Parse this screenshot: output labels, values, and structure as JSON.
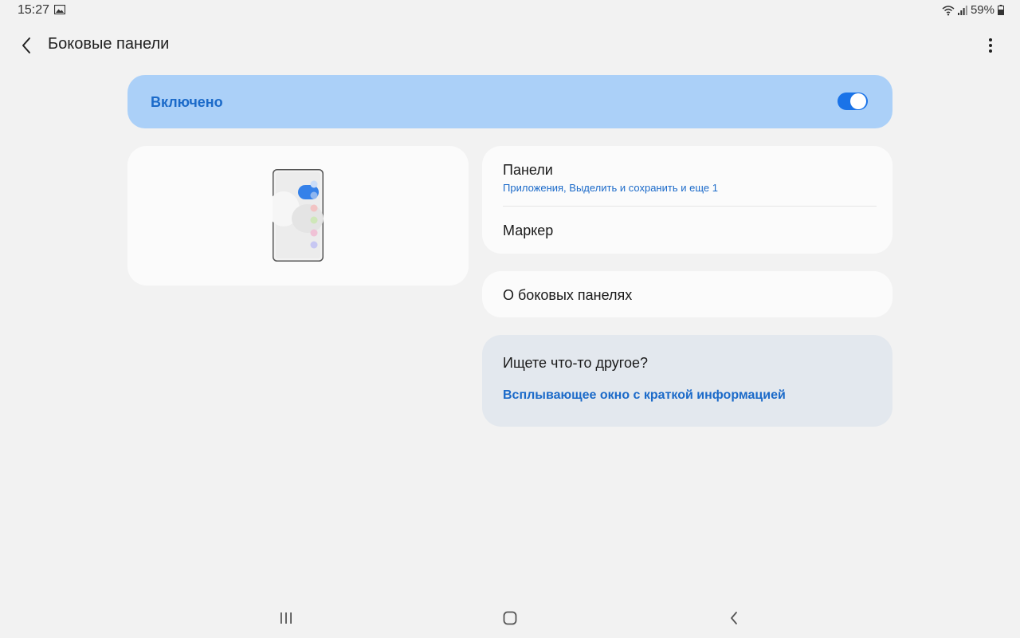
{
  "status_bar": {
    "time": "15:27",
    "battery": "59%"
  },
  "app_bar": {
    "title": "Боковые панели"
  },
  "master_switch": {
    "label": "Включено",
    "checked": true,
    "accent": "#1a73e8"
  },
  "settings": {
    "panels": {
      "title": "Панели",
      "summary": "Приложения, Выделить и сохранить и еще 1"
    },
    "marker": {
      "title": "Маркер"
    },
    "about": {
      "title": "О боковых панелях"
    }
  },
  "help": {
    "title": "Ищете что-то другое?",
    "link": "Всплывающее окно с краткой информацией"
  },
  "icons": {
    "back": "back-arrow-icon",
    "more": "more-vert-icon",
    "recents": "recents-icon",
    "home": "home-icon",
    "nav_back": "nav-back-icon"
  }
}
